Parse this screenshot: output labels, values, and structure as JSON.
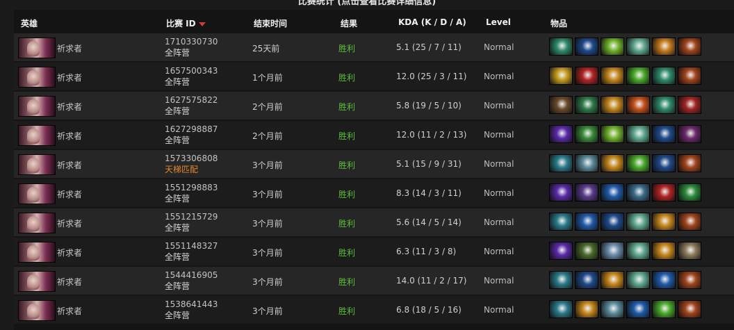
{
  "page": {
    "title": "比赛统计 (点击查看比赛详细信息)"
  },
  "table": {
    "headers": {
      "hero": "英雄",
      "match_id": "比赛 ID",
      "end_time": "结束时间",
      "result": "结果",
      "kda": "KDA (K / D / A)",
      "level": "Level",
      "items": "物品"
    },
    "rows": [
      {
        "hero": "祈求者",
        "match_id": "1710330730",
        "mode": "全阵营",
        "time": "25天前",
        "result": "胜利",
        "kda": "5.1 (25 / 7 / 11)",
        "level": "Normal"
      },
      {
        "hero": "祈求者",
        "match_id": "1657500343",
        "mode": "全阵营",
        "time": "1个月前",
        "result": "胜利",
        "kda": "12.0 (25 / 3 / 11)",
        "level": "Normal"
      },
      {
        "hero": "祈求者",
        "match_id": "1627575822",
        "mode": "全阵营",
        "time": "2个月前",
        "result": "胜利",
        "kda": "5.8 (19 / 5 / 10)",
        "level": "Normal"
      },
      {
        "hero": "祈求者",
        "match_id": "1627298887",
        "mode": "全阵营",
        "time": "2个月前",
        "result": "胜利",
        "kda": "12.0 (11 / 2 / 13)",
        "level": "Normal"
      },
      {
        "hero": "祈求者",
        "match_id": "1573306808",
        "mode": "天梯匹配",
        "time": "3个月前",
        "result": "胜利",
        "kda": "5.1 (15 / 9 / 31)",
        "level": "Normal"
      },
      {
        "hero": "祈求者",
        "match_id": "1551298883",
        "mode": "全阵营",
        "time": "3个月前",
        "result": "胜利",
        "kda": "8.3 (14 / 3 / 11)",
        "level": "Normal"
      },
      {
        "hero": "祈求者",
        "match_id": "1551215729",
        "mode": "全阵营",
        "time": "3个月前",
        "result": "胜利",
        "kda": "5.6 (14 / 5 / 14)",
        "level": "Normal"
      },
      {
        "hero": "祈求者",
        "match_id": "1551148327",
        "mode": "全阵营",
        "time": "3个月前",
        "result": "胜利",
        "kda": "6.3 (11 / 3 / 8)",
        "level": "Normal"
      },
      {
        "hero": "祈求者",
        "match_id": "1544416905",
        "mode": "全阵营",
        "time": "3个月前",
        "result": "胜利",
        "kda": "14.0 (11 / 2 / 17)",
        "level": "Normal"
      },
      {
        "hero": "祈求者",
        "match_id": "1538641443",
        "mode": "全阵营",
        "time": "3个月前",
        "result": "胜利",
        "kda": "6.8 (18 / 5 / 16)",
        "level": "Normal"
      }
    ]
  },
  "item_colors": [
    [
      "#2f8a6c",
      "#1f4a8a",
      "#6fb22a",
      "#5fa890",
      "#c47a1c",
      "#a0441c"
    ],
    [
      "#c49a1c",
      "#b02424",
      "#c4861c",
      "#4aa82a",
      "#2f8a6c",
      "#a0441c"
    ],
    [
      "#6a4a2a",
      "#2f7a4c",
      "#c4861c",
      "#c4501c",
      "#2f8a6c",
      "#a02424"
    ],
    [
      "#5a2aa8",
      "#3a8a3a",
      "#6fb22a",
      "#5fa890",
      "#1f4a8a",
      "#6a2a6a"
    ],
    [
      "#2a7a8a",
      "#5a8a9a",
      "#c4861c",
      "#4aa82a",
      "#1f4a8a",
      "#a0441c"
    ],
    [
      "#5a2aa8",
      "#5a3a8a",
      "#1f5aa8",
      "#3a6a8a",
      "#b02424",
      "#2a8a3a"
    ],
    [
      "#2a7a8a",
      "#1f5aa8",
      "#1f4a8a",
      "#5fa890",
      "#c4861c",
      "#a0441c"
    ],
    [
      "#5a2aa8",
      "#4a6a2a",
      "#6a8aaa",
      "#5fa890",
      "#c4861c",
      "#8a7a5a"
    ],
    [
      "#2a7a8a",
      "#1f4a8a",
      "#c4861c",
      "#5fa890",
      "#1f5aa8",
      "#a0441c"
    ],
    [
      "#2a7a8a",
      "#c4861c",
      "#5a8a9a",
      "#1f5aa8",
      "#4aa82a",
      "#a0441c"
    ]
  ]
}
